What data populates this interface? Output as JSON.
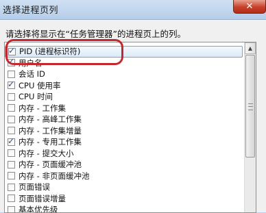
{
  "window": {
    "title": "选择进程页列",
    "close_glyph": "✕"
  },
  "instruction": "请选择将显示在“任务管理器”的进程页上的列。",
  "columns": [
    {
      "label": "PID (进程标识符)",
      "checked": true,
      "selected": true
    },
    {
      "label": "用户名",
      "checked": true
    },
    {
      "label": "会话 ID",
      "checked": false
    },
    {
      "label": "CPU 使用率",
      "checked": true
    },
    {
      "label": "CPU 时间",
      "checked": false
    },
    {
      "label": "内存 - 工作集",
      "checked": false
    },
    {
      "label": "内存 - 高峰工作集",
      "checked": false
    },
    {
      "label": "内存 - 工作集增量",
      "checked": false
    },
    {
      "label": "内存 - 专用工作集",
      "checked": true
    },
    {
      "label": "内存 - 提交大小",
      "checked": false
    },
    {
      "label": "内存 - 页面缓冲池",
      "checked": false
    },
    {
      "label": "内存 - 非页面缓冲池",
      "checked": false
    },
    {
      "label": "页面错误",
      "checked": false
    },
    {
      "label": "页面错误增量",
      "checked": false
    },
    {
      "label": "基本优先级",
      "checked": false
    }
  ],
  "check_glyph": "✓",
  "scroll_up_glyph": "▲",
  "accent_colors": {
    "annotation": "#c4282d",
    "selection_border": "#7da2ce"
  }
}
